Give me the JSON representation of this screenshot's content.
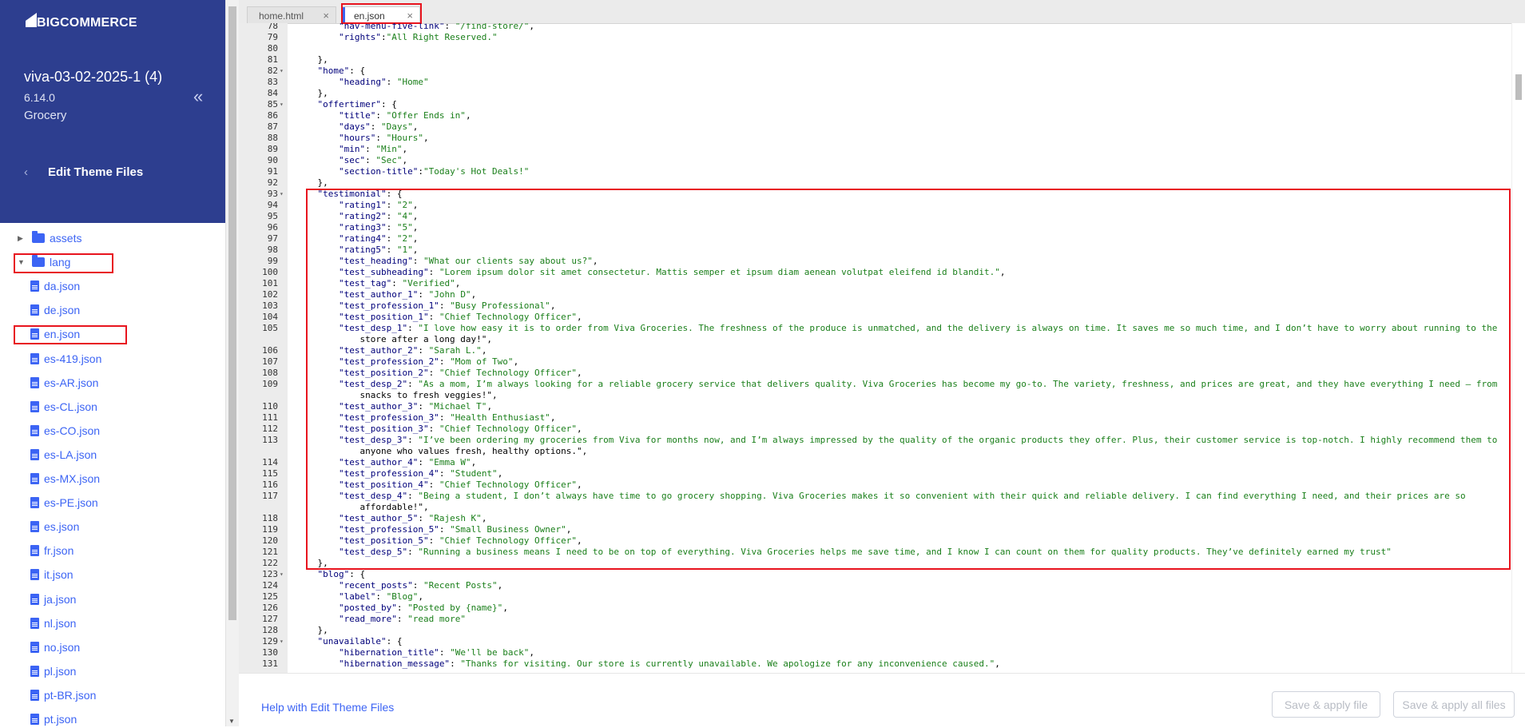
{
  "brand": {
    "logo_text": "BIGCOMMERCE"
  },
  "store": {
    "name": "viva-03-02-2025-1 (4)",
    "version": "6.14.0",
    "category": "Grocery"
  },
  "nav": {
    "edit_theme_files": "Edit Theme Files",
    "collapse_icon": "double-chevron-left-icon"
  },
  "tree": [
    {
      "label": "assets",
      "type": "folder",
      "expanded": false
    },
    {
      "label": "lang",
      "type": "folder",
      "expanded": true
    },
    {
      "label": "da.json",
      "type": "file"
    },
    {
      "label": "de.json",
      "type": "file"
    },
    {
      "label": "en.json",
      "type": "file"
    },
    {
      "label": "es-419.json",
      "type": "file"
    },
    {
      "label": "es-AR.json",
      "type": "file"
    },
    {
      "label": "es-CL.json",
      "type": "file"
    },
    {
      "label": "es-CO.json",
      "type": "file"
    },
    {
      "label": "es-LA.json",
      "type": "file"
    },
    {
      "label": "es-MX.json",
      "type": "file"
    },
    {
      "label": "es-PE.json",
      "type": "file"
    },
    {
      "label": "es.json",
      "type": "file"
    },
    {
      "label": "fr.json",
      "type": "file"
    },
    {
      "label": "it.json",
      "type": "file"
    },
    {
      "label": "ja.json",
      "type": "file"
    },
    {
      "label": "nl.json",
      "type": "file"
    },
    {
      "label": "no.json",
      "type": "file"
    },
    {
      "label": "pl.json",
      "type": "file"
    },
    {
      "label": "pt-BR.json",
      "type": "file"
    },
    {
      "label": "pt.json",
      "type": "file"
    }
  ],
  "tabs": [
    {
      "label": "home.html",
      "close": "×",
      "active": false
    },
    {
      "label": "en.json",
      "close": "×",
      "active": true
    }
  ],
  "code_lines": [
    {
      "n": "78",
      "fold": false,
      "text": "        \"nav-menu-five-link\": \"/find-store/\","
    },
    {
      "n": "79",
      "fold": false,
      "text": "        \"rights\":\"All Right Reserved.\""
    },
    {
      "n": "80",
      "fold": false,
      "text": ""
    },
    {
      "n": "81",
      "fold": false,
      "text": "    },"
    },
    {
      "n": "82",
      "fold": true,
      "text": "    \"home\": {"
    },
    {
      "n": "83",
      "fold": false,
      "text": "        \"heading\": \"Home\""
    },
    {
      "n": "84",
      "fold": false,
      "text": "    },"
    },
    {
      "n": "85",
      "fold": true,
      "text": "    \"offertimer\": {"
    },
    {
      "n": "86",
      "fold": false,
      "text": "        \"title\": \"Offer Ends in\","
    },
    {
      "n": "87",
      "fold": false,
      "text": "        \"days\": \"Days\","
    },
    {
      "n": "88",
      "fold": false,
      "text": "        \"hours\": \"Hours\","
    },
    {
      "n": "89",
      "fold": false,
      "text": "        \"min\": \"Min\","
    },
    {
      "n": "90",
      "fold": false,
      "text": "        \"sec\": \"Sec\","
    },
    {
      "n": "91",
      "fold": false,
      "text": "        \"section-title\":\"Today's Hot Deals!\""
    },
    {
      "n": "92",
      "fold": false,
      "text": "    },"
    },
    {
      "n": "93",
      "fold": true,
      "text": "    \"testimonial\": {"
    },
    {
      "n": "94",
      "fold": false,
      "text": "        \"rating1\": \"2\","
    },
    {
      "n": "95",
      "fold": false,
      "text": "        \"rating2\": \"4\","
    },
    {
      "n": "96",
      "fold": false,
      "text": "        \"rating3\": \"5\","
    },
    {
      "n": "97",
      "fold": false,
      "text": "        \"rating4\": \"2\","
    },
    {
      "n": "98",
      "fold": false,
      "text": "        \"rating5\": \"1\","
    },
    {
      "n": "99",
      "fold": false,
      "text": "        \"test_heading\": \"What our clients say about us?\","
    },
    {
      "n": "100",
      "fold": false,
      "text": "        \"test_subheading\": \"Lorem ipsum dolor sit amet consectetur. Mattis semper et ipsum diam aenean volutpat eleifend id blandit.\","
    },
    {
      "n": "101",
      "fold": false,
      "text": "        \"test_tag\": \"Verified\","
    },
    {
      "n": "102",
      "fold": false,
      "text": "        \"test_author_1\": \"John D\","
    },
    {
      "n": "103",
      "fold": false,
      "text": "        \"test_profession_1\": \"Busy Professional\","
    },
    {
      "n": "104",
      "fold": false,
      "text": "        \"test_position_1\": \"Chief Technology Officer\","
    },
    {
      "n": "105",
      "fold": false,
      "text": "        \"test_desp_1\": \"I love how easy it is to order from Viva Groceries. The freshness of the produce is unmatched, and the delivery is always on time. It saves me so much time, and I don’t have to worry about running to the"
    },
    {
      "n": "",
      "fold": false,
      "text": "            store after a long day!\","
    },
    {
      "n": "106",
      "fold": false,
      "text": "        \"test_author_2\": \"Sarah L.\","
    },
    {
      "n": "107",
      "fold": false,
      "text": "        \"test_profession_2\": \"Mom of Two\","
    },
    {
      "n": "108",
      "fold": false,
      "text": "        \"test_position_2\": \"Chief Technology Officer\","
    },
    {
      "n": "109",
      "fold": false,
      "text": "        \"test_desp_2\": \"As a mom, I’m always looking for a reliable grocery service that delivers quality. Viva Groceries has become my go-to. The variety, freshness, and prices are great, and they have everything I need – from"
    },
    {
      "n": "",
      "fold": false,
      "text": "            snacks to fresh veggies!\","
    },
    {
      "n": "110",
      "fold": false,
      "text": "        \"test_author_3\": \"Michael T\","
    },
    {
      "n": "111",
      "fold": false,
      "text": "        \"test_profession_3\": \"Health Enthusiast\","
    },
    {
      "n": "112",
      "fold": false,
      "text": "        \"test_position_3\": \"Chief Technology Officer\","
    },
    {
      "n": "113",
      "fold": false,
      "text": "        \"test_desp_3\": \"I’ve been ordering my groceries from Viva for months now, and I’m always impressed by the quality of the organic products they offer. Plus, their customer service is top-notch. I highly recommend them to"
    },
    {
      "n": "",
      "fold": false,
      "text": "            anyone who values fresh, healthy options.\","
    },
    {
      "n": "114",
      "fold": false,
      "text": "        \"test_author_4\": \"Emma W\","
    },
    {
      "n": "115",
      "fold": false,
      "text": "        \"test_profession_4\": \"Student\","
    },
    {
      "n": "116",
      "fold": false,
      "text": "        \"test_position_4\": \"Chief Technology Officer\","
    },
    {
      "n": "117",
      "fold": false,
      "text": "        \"test_desp_4\": \"Being a student, I don’t always have time to go grocery shopping. Viva Groceries makes it so convenient with their quick and reliable delivery. I can find everything I need, and their prices are so"
    },
    {
      "n": "",
      "fold": false,
      "text": "            affordable!\","
    },
    {
      "n": "118",
      "fold": false,
      "text": "        \"test_author_5\": \"Rajesh K\","
    },
    {
      "n": "119",
      "fold": false,
      "text": "        \"test_profession_5\": \"Small Business Owner\","
    },
    {
      "n": "120",
      "fold": false,
      "text": "        \"test_position_5\": \"Chief Technology Officer\","
    },
    {
      "n": "121",
      "fold": false,
      "text": "        \"test_desp_5\": \"Running a business means I need to be on top of everything. Viva Groceries helps me save time, and I know I can count on them for quality products. They’ve definitely earned my trust\""
    },
    {
      "n": "122",
      "fold": false,
      "text": "    },"
    },
    {
      "n": "123",
      "fold": true,
      "text": "    \"blog\": {"
    },
    {
      "n": "124",
      "fold": false,
      "text": "        \"recent_posts\": \"Recent Posts\","
    },
    {
      "n": "125",
      "fold": false,
      "text": "        \"label\": \"Blog\","
    },
    {
      "n": "126",
      "fold": false,
      "text": "        \"posted_by\": \"Posted by {name}\","
    },
    {
      "n": "127",
      "fold": false,
      "text": "        \"read_more\": \"read more\""
    },
    {
      "n": "128",
      "fold": false,
      "text": "    },"
    },
    {
      "n": "129",
      "fold": true,
      "text": "    \"unavailable\": {"
    },
    {
      "n": "130",
      "fold": false,
      "text": "        \"hibernation_title\": \"We'll be back\","
    },
    {
      "n": "131",
      "fold": false,
      "text": "        \"hibernation_message\": \"Thanks for visiting. Our store is currently unavailable. We apologize for any inconvenience caused.\","
    }
  ],
  "footer": {
    "help": "Help with Edit Theme Files",
    "save_apply_file": "Save & apply file",
    "save_apply_all": "Save & apply all files"
  },
  "colors": {
    "header_bg": "#2d3e8f",
    "link": "#3c64f4",
    "highlight": "#e8141e",
    "string": "#1a7f1a",
    "key": "#00007a"
  }
}
